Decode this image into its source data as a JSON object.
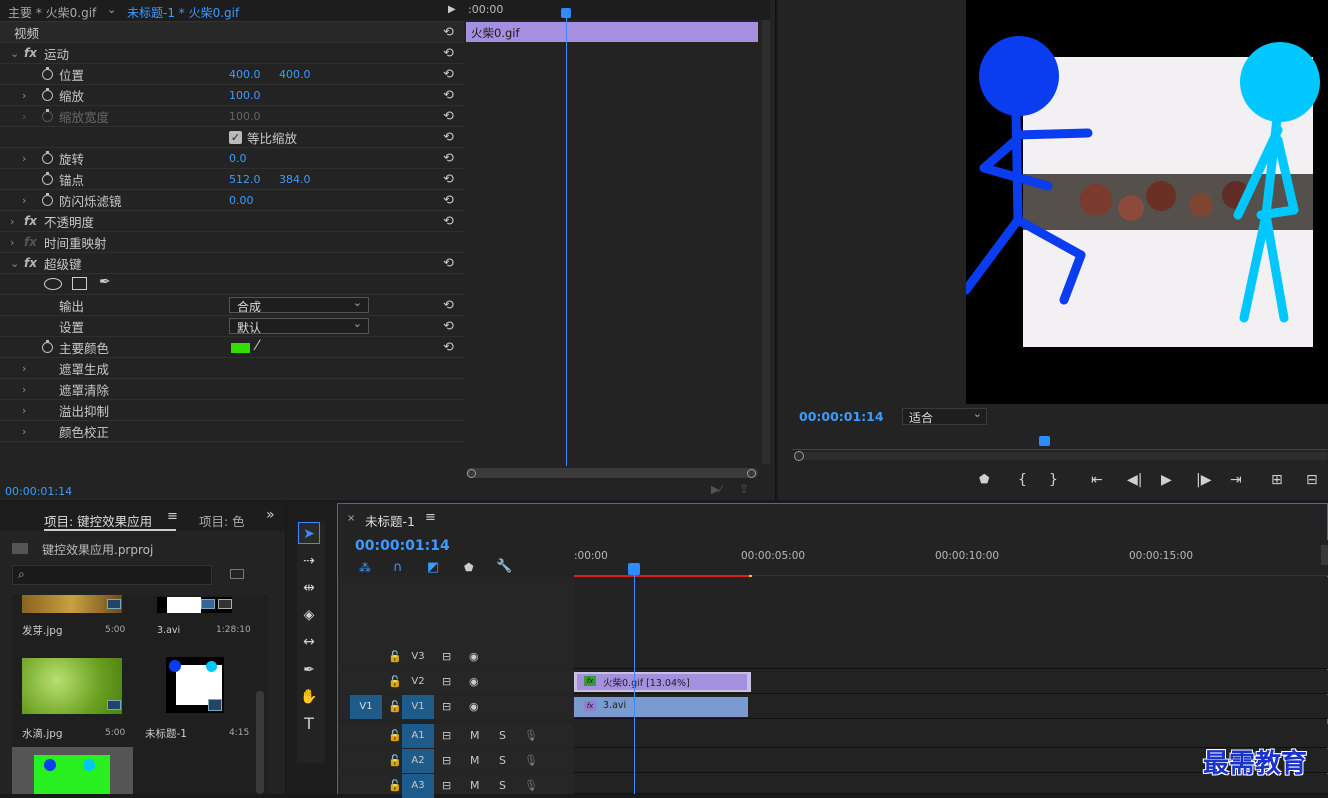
{
  "effect_controls": {
    "tabs": [
      "主要 * 火柴0.gif",
      "未标题-1 * 火柴0.gif"
    ],
    "section_video": "视频",
    "properties": [
      {
        "name": "运动",
        "kind": "fx"
      },
      {
        "name": "位置",
        "values": [
          "400.0",
          "400.0"
        ]
      },
      {
        "name": "缩放",
        "values": [
          "100.0"
        ]
      },
      {
        "name": "缩放宽度",
        "values": [
          "100.0"
        ],
        "disabled": true
      },
      {
        "name": "等比缩放",
        "checkbox": true
      },
      {
        "name": "旋转",
        "values": [
          "0.0"
        ]
      },
      {
        "name": "锚点",
        "values": [
          "512.0",
          "384.0"
        ]
      },
      {
        "name": "防闪烁滤镜",
        "values": [
          "0.00"
        ]
      },
      {
        "name": "不透明度",
        "kind": "fx"
      },
      {
        "name": "时间重映射",
        "kind": "fx"
      },
      {
        "name": "超级键",
        "kind": "fx"
      },
      {
        "name": "输出",
        "dropdown": "合成"
      },
      {
        "name": "设置",
        "dropdown": "默认"
      },
      {
        "name": "主要颜色",
        "color": "#33dd00"
      },
      {
        "name": "遮罩生成"
      },
      {
        "name": "遮罩清除"
      },
      {
        "name": "溢出抑制"
      },
      {
        "name": "颜色校正"
      }
    ],
    "mini_timeline_time": ":00:00",
    "mini_clip_label": "火柴0.gif",
    "timecode": "00:00:01:14"
  },
  "program_monitor": {
    "timecode": "00:00:01:14",
    "fit_label": "适合"
  },
  "project": {
    "tab_label": "项目: 键控效果应用",
    "tab2_label": "项目: 色",
    "file_name": "键控效果应用.prproj",
    "items": [
      {
        "name": "发芽.jpg",
        "duration": "5:00"
      },
      {
        "name": "3.avi",
        "duration": "1:28:10"
      },
      {
        "name": "水滴.jpg",
        "duration": "5:00"
      },
      {
        "name": "未标题-1",
        "duration": "4:15"
      }
    ]
  },
  "timeline": {
    "tab_label": "未标题-1",
    "timecode": "00:00:01:14",
    "ruler": [
      ":00:00",
      "00:00:05:00",
      "00:00:10:00",
      "00:00:15:00"
    ],
    "tracks": [
      "V3",
      "V2",
      "V1",
      "A1",
      "A2",
      "A3"
    ],
    "source_v1": "V1",
    "clip_v2": "火柴0.gif [13.04%]",
    "clip_v1": "3.avi",
    "m": "M",
    "s": "S"
  },
  "watermark": "最需教育"
}
